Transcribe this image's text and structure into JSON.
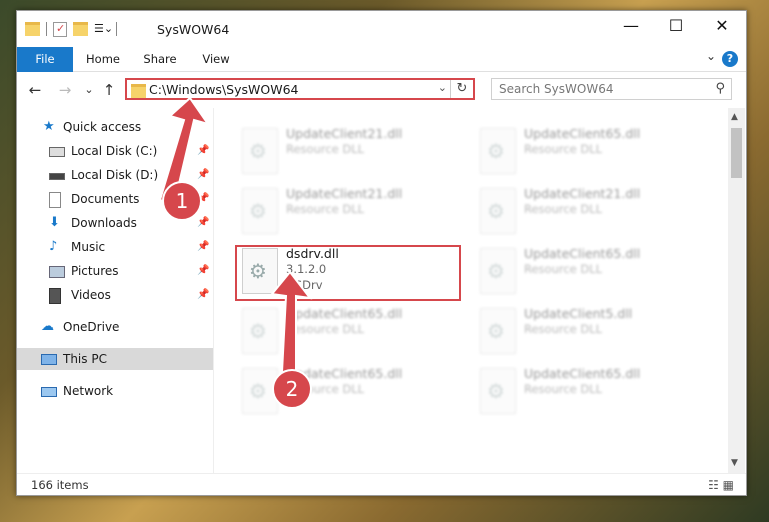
{
  "window": {
    "title": "SysWOW64",
    "minimize": "—",
    "maximize": "☐",
    "close": "✕"
  },
  "ribbon": {
    "tabs": [
      "File",
      "Home",
      "Share",
      "View"
    ],
    "help": "?",
    "expand": "⌄"
  },
  "nav": {
    "back": "←",
    "forward": "→",
    "recent": "⌄",
    "up": "↑",
    "address": "C:\\Windows\\SysWOW64",
    "address_dropdown": "⌄",
    "refresh": "↻",
    "search_placeholder": "Search SysWOW64",
    "search_icon": "⚲"
  },
  "sidebar": {
    "items": [
      {
        "label": "Quick access",
        "icon": "star-icon",
        "pinned": false
      },
      {
        "label": "Local Disk (C:)",
        "icon": "drive-icon",
        "pinned": true
      },
      {
        "label": "Local Disk (D:)",
        "icon": "drive-icon",
        "pinned": true
      },
      {
        "label": "Documents",
        "icon": "documents-icon",
        "pinned": true
      },
      {
        "label": "Downloads",
        "icon": "download-icon",
        "pinned": true
      },
      {
        "label": "Music",
        "icon": "music-icon",
        "pinned": true
      },
      {
        "label": "Pictures",
        "icon": "pictures-icon",
        "pinned": true
      },
      {
        "label": "Videos",
        "icon": "videos-icon",
        "pinned": true
      },
      {
        "label": "OneDrive",
        "icon": "cloud-icon",
        "pinned": false
      },
      {
        "label": "This PC",
        "icon": "computer-icon",
        "pinned": false,
        "selected": true
      },
      {
        "label": "Network",
        "icon": "network-icon",
        "pinned": false
      }
    ]
  },
  "files": [
    {
      "name": "UpdateClient21.dll",
      "type": "Resource DLL",
      "blurred": true
    },
    {
      "name": "UpdateClient65.dll",
      "type": "Resource DLL",
      "blurred": true
    },
    {
      "name": "UpdateClient21.dll",
      "type": "Resource DLL",
      "blurred": true
    },
    {
      "name": "UpdateClient21.dll",
      "type": "Resource DLL",
      "blurred": true
    },
    {
      "name": "dsdrv.dll",
      "type": "3.1.2.0",
      "company": "DSDrv",
      "blurred": false,
      "highlighted": true
    },
    {
      "name": "UpdateClient65.dll",
      "type": "Resource DLL",
      "blurred": true
    },
    {
      "name": "UpdateClient65.dll",
      "type": "Resource DLL",
      "blurred": true
    },
    {
      "name": "UpdateClient5.dll",
      "type": "Resource DLL",
      "blurred": true
    },
    {
      "name": "UpdateClient65.dll",
      "type": "Resource DLL",
      "blurred": true
    },
    {
      "name": "UpdateClient65.dll",
      "type": "Resource DLL",
      "blurred": true
    }
  ],
  "status": {
    "item_count": "166 items",
    "view_icons": "☷ ▦"
  },
  "annotations": {
    "badge1": "1",
    "badge2": "2",
    "color": "#d6474c"
  }
}
